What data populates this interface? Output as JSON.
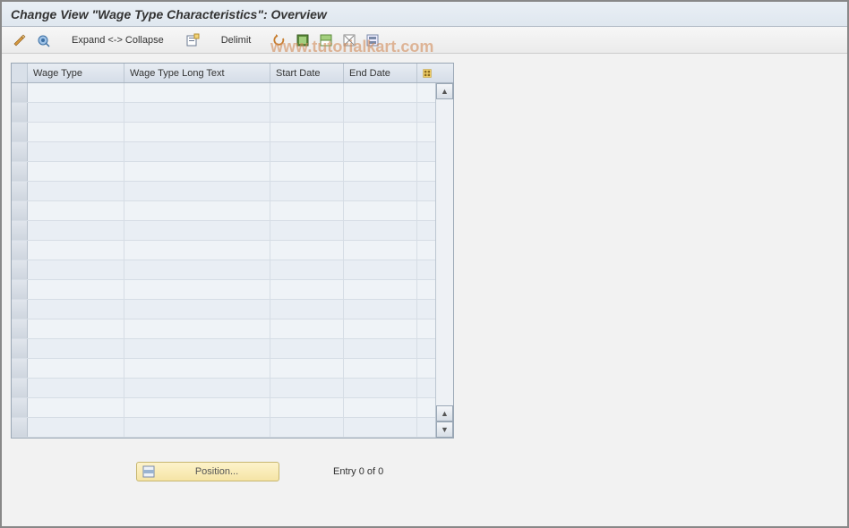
{
  "header": {
    "title": "Change View \"Wage Type Characteristics\": Overview"
  },
  "toolbar": {
    "expand_collapse_label": "Expand <-> Collapse",
    "delimit_label": "Delimit"
  },
  "grid": {
    "columns": {
      "wage_type": "Wage Type",
      "wage_type_long_text": "Wage Type Long Text",
      "start_date": "Start Date",
      "end_date": "End Date"
    },
    "rows": [
      "",
      "",
      "",
      "",
      "",
      "",
      "",
      "",
      "",
      "",
      "",
      "",
      "",
      "",
      "",
      "",
      "",
      ""
    ]
  },
  "footer": {
    "position_label": "Position...",
    "entry_status": "Entry 0 of 0"
  },
  "watermark": "www.tutorialkart.com"
}
